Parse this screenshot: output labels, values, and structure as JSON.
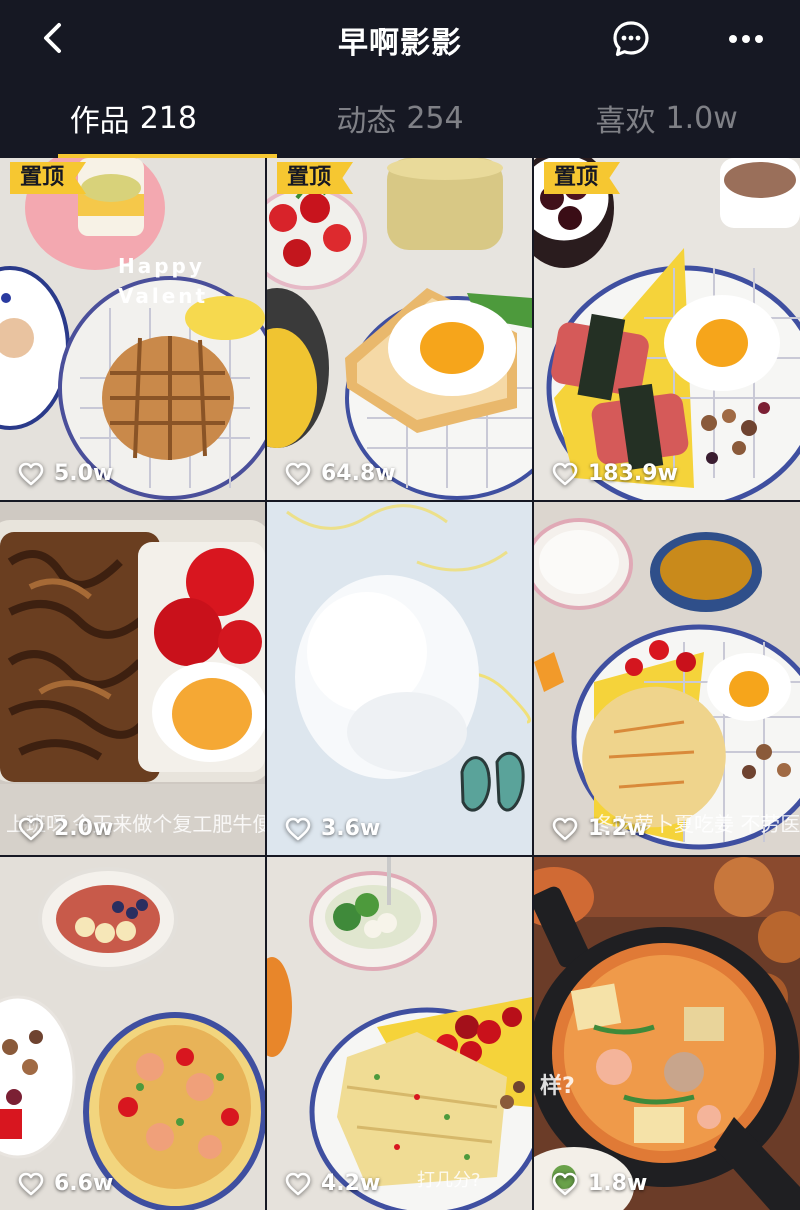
{
  "header": {
    "title": "早啊影影",
    "back_icon": "chevron-left-icon",
    "message_icon": "message-icon",
    "more_icon": "more-icon"
  },
  "tabs": [
    {
      "label": "作品",
      "count": "218",
      "active": true
    },
    {
      "label": "动态",
      "count": "254",
      "active": false
    },
    {
      "label": "喜欢",
      "count": "1.0w",
      "active": false
    }
  ],
  "colors": {
    "background": "#161823",
    "accent": "#f6c731"
  },
  "videos": [
    {
      "pinned": true,
      "pin_label": "置顶",
      "likes": "5.0w",
      "overlay": "Happy Valent"
    },
    {
      "pinned": true,
      "pin_label": "置顶",
      "likes": "64.8w",
      "overlay": ""
    },
    {
      "pinned": true,
      "pin_label": "置顶",
      "likes": "183.9w",
      "overlay": ""
    },
    {
      "pinned": false,
      "pin_label": "",
      "likes": "2.0w",
      "overlay": "上班呀 今天来做个复工肥牛便当"
    },
    {
      "pinned": false,
      "pin_label": "",
      "likes": "3.6w",
      "overlay": ""
    },
    {
      "pinned": false,
      "pin_label": "",
      "likes": "1.2w",
      "overlay": "冬吃萝卜夏吃姜 不劳医生"
    },
    {
      "pinned": false,
      "pin_label": "",
      "likes": "6.6w",
      "overlay": ""
    },
    {
      "pinned": false,
      "pin_label": "",
      "likes": "4.2w",
      "overlay": "打几分?"
    },
    {
      "pinned": false,
      "pin_label": "",
      "likes": "1.8w",
      "overlay": "样?"
    }
  ]
}
